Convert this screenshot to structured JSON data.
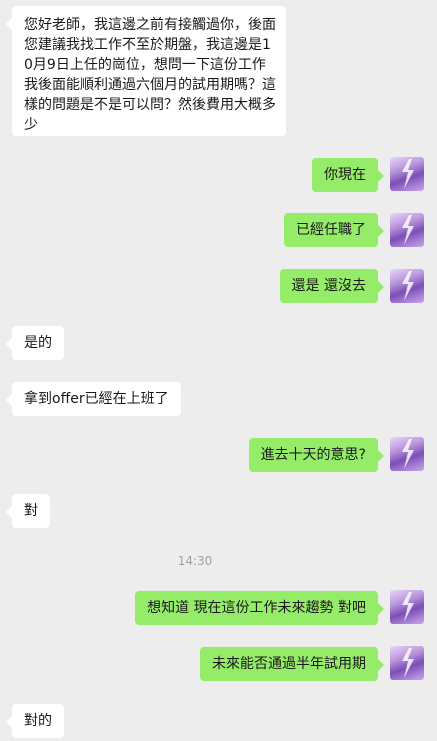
{
  "messages": [
    {
      "side": "in",
      "text": "您好老師，我這邊之前有接觸過你，後面您建議我找工作不至於期盤，我這邊是10月9日上任的崗位，想問一下這份工作我後面能順利通過六個月的試用期嗎？這樣的問題是不是可以問？然後費用大概多少"
    },
    {
      "side": "out",
      "text": "你現在"
    },
    {
      "side": "out",
      "text": "已經任職了"
    },
    {
      "side": "out",
      "text": "還是 還沒去"
    },
    {
      "side": "in",
      "text": "是的"
    },
    {
      "side": "in",
      "text": "拿到offer已經在上班了"
    },
    {
      "side": "out",
      "text": "進去十天的意思?"
    },
    {
      "side": "in",
      "text": "對"
    },
    {
      "side": "out",
      "text": "想知道 現在這份工作未來趨勢 對吧"
    },
    {
      "side": "out",
      "text": "未來能否通過半年試用期"
    },
    {
      "side": "in",
      "text": "對的"
    }
  ],
  "timestamp": "14:30",
  "colors": {
    "background": "#ededed",
    "incoming_bubble": "#ffffff",
    "outgoing_bubble": "#95ec69"
  },
  "avatar_icon": "user-avatar-purple-lightning"
}
